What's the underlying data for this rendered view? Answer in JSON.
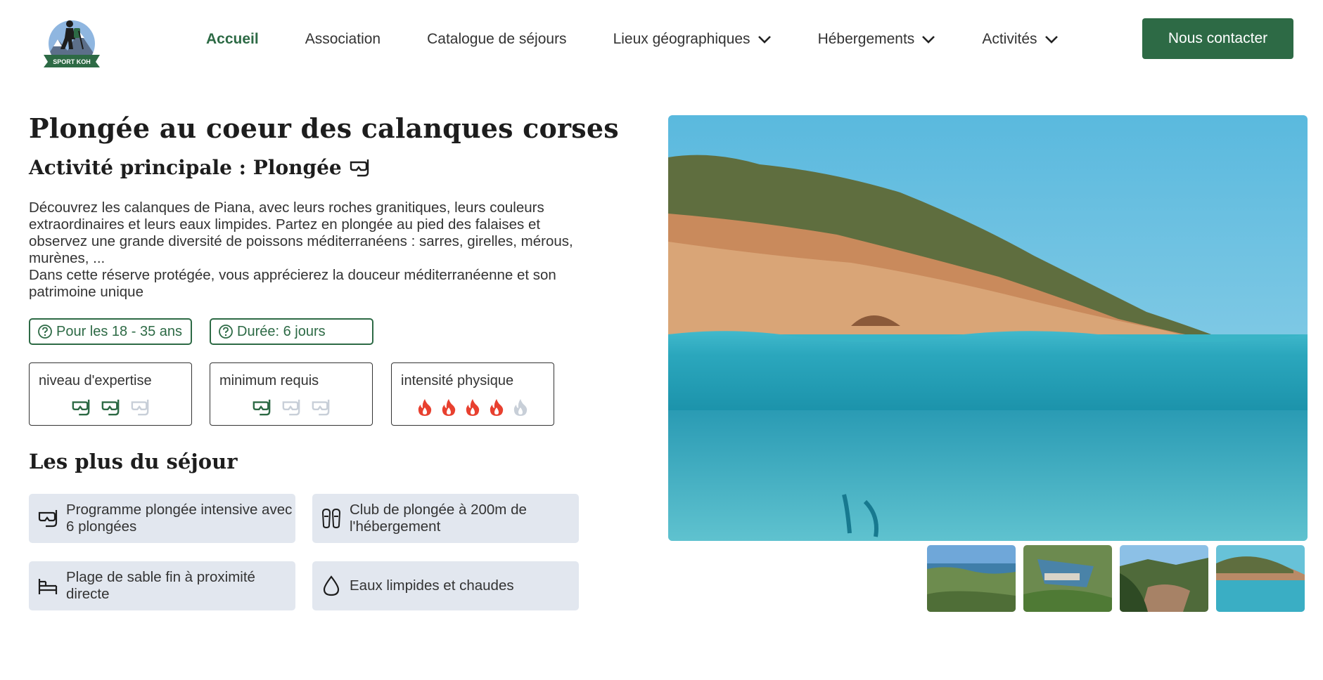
{
  "header": {
    "logo_text": "SPORT KOH",
    "nav": [
      {
        "label": "Accueil",
        "active": true,
        "dropdown": false
      },
      {
        "label": "Association",
        "active": false,
        "dropdown": false
      },
      {
        "label": "Catalogue de séjours",
        "active": false,
        "dropdown": false
      },
      {
        "label": "Lieux géographiques",
        "active": false,
        "dropdown": true
      },
      {
        "label": "Hébergements",
        "active": false,
        "dropdown": true
      },
      {
        "label": "Activités",
        "active": false,
        "dropdown": true
      }
    ],
    "contact_label": "Nous contacter"
  },
  "trip": {
    "title": "Plongée au coeur des calanques corses",
    "subtitle": "Activité principale : Plongée",
    "subtitle_icon": "diving-mask-icon",
    "description": [
      "Découvrez les calanques de Piana, avec leurs roches granitiques, leurs couleurs extraordinaires et leurs eaux limpides. Partez en plongée au pied des falaises et observez une grande diversité de poissons méditerranéens : sarres, girelles, mérous, murènes, ...",
      "Dans cette réserve protégée, vous apprécierez la douceur méditerranéenne et son patrimoine unique"
    ],
    "tags": [
      {
        "label": "Pour les 18 - 35 ans",
        "icon": "question-circle-icon"
      },
      {
        "label": "Durée: 6 jours",
        "icon": "question-circle-icon"
      }
    ],
    "levels": [
      {
        "label": "niveau d'expertise",
        "icon": "diving-mask-icon",
        "value": 2,
        "max": 3
      },
      {
        "label": "minimum requis",
        "icon": "diving-mask-icon",
        "value": 1,
        "max": 3
      },
      {
        "label": "intensité physique",
        "icon": "flame-icon",
        "value": 4,
        "max": 5
      }
    ],
    "plus_title": "Les plus du séjour",
    "features": [
      {
        "label": "Programme plongée intensive avec 6 plongées",
        "icon": "diving-mask-icon"
      },
      {
        "label": "Club de plongée à 200m de l'hébergement",
        "icon": "flippers-icon"
      },
      {
        "label": "Plage de sable fin à proximité directe",
        "icon": "beach-chair-icon"
      },
      {
        "label": "Eaux limpides et chaudes",
        "icon": "water-drop-icon"
      }
    ]
  },
  "gallery": {
    "main_image": "underwater-cliff-photo",
    "thumbnails": [
      "calanque-coast-thumb",
      "harbor-village-thumb",
      "beach-cove-thumb",
      "cliff-sea-thumb"
    ]
  },
  "colors": {
    "accent": "#2d6a45",
    "feature_bg": "#e2e7ef",
    "flame_active": "#e8402f",
    "icon_inactive": "#c8cfd8"
  }
}
